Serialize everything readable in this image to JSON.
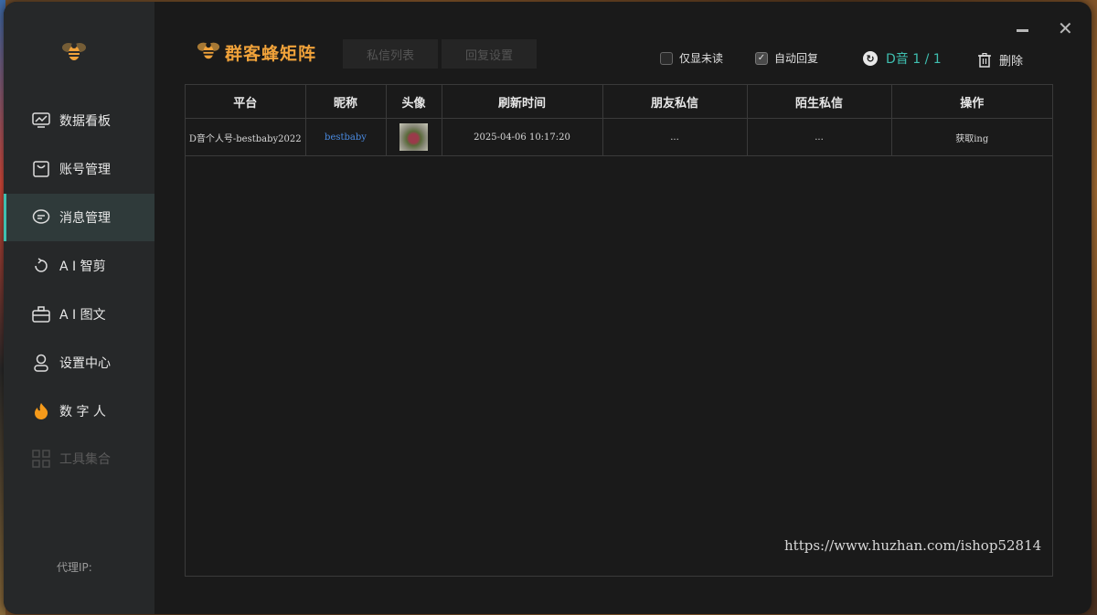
{
  "app": {
    "brand": "群客蜂矩阵"
  },
  "sidebar": {
    "items": [
      {
        "label": "数据看板",
        "icon": "dashboard-icon"
      },
      {
        "label": "账号管理",
        "icon": "account-icon"
      },
      {
        "label": "消息管理",
        "icon": "message-icon",
        "active": true
      },
      {
        "label": "A I 智剪",
        "icon": "ai-clip-icon"
      },
      {
        "label": "A I 图文",
        "icon": "briefcase-icon"
      },
      {
        "label": "设置中心",
        "icon": "settings-icon"
      },
      {
        "label": "数 字 人",
        "icon": "flame-icon"
      },
      {
        "label": "工具集合",
        "icon": "grid-icon",
        "disabled": true
      }
    ],
    "proxy_label": "代理IP:"
  },
  "tabs": [
    {
      "label": "私信列表"
    },
    {
      "label": "回复设置"
    }
  ],
  "toolbar": {
    "unread_only_label": "仅显未读",
    "unread_only_checked": false,
    "auto_reply_label": "自动回复",
    "auto_reply_checked": true,
    "account_label": "D音 1 / 1",
    "delete_label": "删除"
  },
  "table": {
    "headers": [
      "平台",
      "昵称",
      "头像",
      "刷新时间",
      "朋友私信",
      "陌生私信",
      "操作"
    ],
    "rows": [
      {
        "platform": "D音个人号-bestbaby2022",
        "nickname": "bestbaby",
        "refresh_time": "2025-04-06 10:17:20",
        "friend_msg": "...",
        "stranger_msg": "...",
        "action": "获取ing"
      }
    ]
  },
  "watermark": "https://www.huzhan.com/ishop52814",
  "colors": {
    "accent": "#3fbfb0",
    "brand": "#f0a23a",
    "link": "#4a8ae0",
    "window_bg": "#1a1a1a",
    "sidebar_bg": "#262829"
  }
}
